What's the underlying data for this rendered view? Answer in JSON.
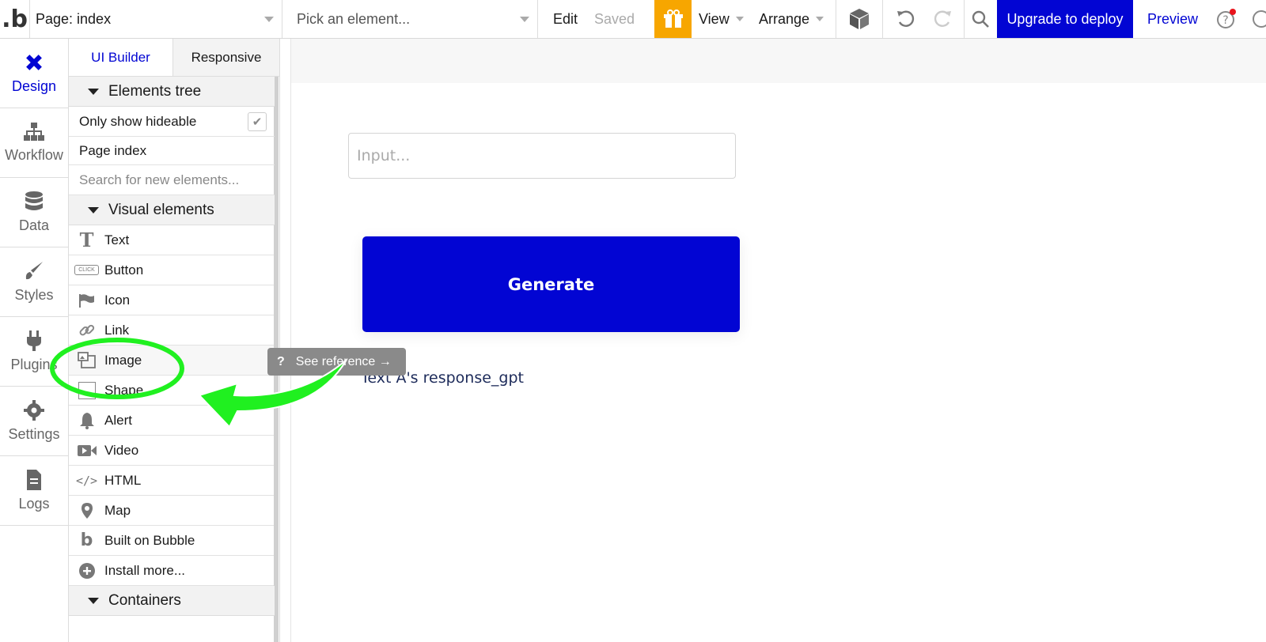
{
  "topbar": {
    "logo": ".b",
    "page_select": "Page: index",
    "element_select": "Pick an element...",
    "edit": "Edit",
    "saved": "Saved",
    "view": "View",
    "arrange": "Arrange",
    "upgrade": "Upgrade to deploy",
    "preview": "Preview",
    "accent": "#0205d3",
    "gift_color": "#f7a600"
  },
  "leftnav": [
    {
      "label": "Design",
      "icon": "design-icon"
    },
    {
      "label": "Workflow",
      "icon": "workflow-icon"
    },
    {
      "label": "Data",
      "icon": "database-icon"
    },
    {
      "label": "Styles",
      "icon": "brush-icon"
    },
    {
      "label": "Plugins",
      "icon": "plug-icon"
    },
    {
      "label": "Settings",
      "icon": "gear-icon"
    },
    {
      "label": "Logs",
      "icon": "document-icon"
    }
  ],
  "panel": {
    "tab_ui": "UI Builder",
    "tab_responsive": "Responsive",
    "elements_tree": "Elements tree",
    "only_hideable": "Only show hideable",
    "page_index": "Page index",
    "search_placeholder": "Search for new elements...",
    "visual_elements": "Visual elements",
    "items": [
      "Text",
      "Button",
      "Icon",
      "Link",
      "Image",
      "Shape",
      "Alert",
      "Video",
      "HTML",
      "Map",
      "Built on Bubble",
      "Install more..."
    ],
    "containers": "Containers",
    "tooltip": "See reference →",
    "button_icon_text": "CLICK"
  },
  "canvas": {
    "input_placeholder": "Input...",
    "generate": "Generate",
    "response_text": "Text A's response_gpt"
  }
}
